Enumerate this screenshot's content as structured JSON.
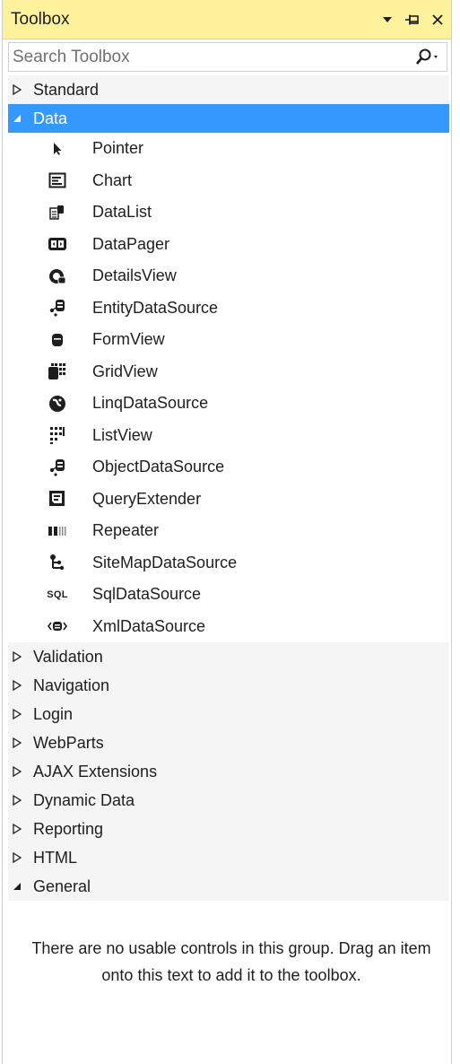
{
  "window": {
    "title": "Toolbox"
  },
  "search": {
    "placeholder": "Search Toolbox"
  },
  "groups_before": [
    {
      "label": "Standard",
      "expanded": false
    }
  ],
  "data_group": {
    "label": "Data",
    "expanded": true,
    "selected": true,
    "items": [
      {
        "label": "Pointer",
        "icon": "pointer-icon"
      },
      {
        "label": "Chart",
        "icon": "chart-icon"
      },
      {
        "label": "DataList",
        "icon": "datalist-icon"
      },
      {
        "label": "DataPager",
        "icon": "datapager-icon"
      },
      {
        "label": "DetailsView",
        "icon": "detailsview-icon"
      },
      {
        "label": "EntityDataSource",
        "icon": "entitydatasource-icon"
      },
      {
        "label": "FormView",
        "icon": "formview-icon"
      },
      {
        "label": "GridView",
        "icon": "gridview-icon"
      },
      {
        "label": "LinqDataSource",
        "icon": "linqdatasource-icon"
      },
      {
        "label": "ListView",
        "icon": "listview-icon"
      },
      {
        "label": "ObjectDataSource",
        "icon": "objectdatasource-icon"
      },
      {
        "label": "QueryExtender",
        "icon": "queryextender-icon"
      },
      {
        "label": "Repeater",
        "icon": "repeater-icon"
      },
      {
        "label": "SiteMapDataSource",
        "icon": "sitemapdatasource-icon"
      },
      {
        "label": "SqlDataSource",
        "icon": "sqldatasource-icon",
        "icon_text": "SQL"
      },
      {
        "label": "XmlDataSource",
        "icon": "xmldatasource-icon"
      }
    ]
  },
  "groups_after": [
    {
      "label": "Validation",
      "expanded": false
    },
    {
      "label": "Navigation",
      "expanded": false
    },
    {
      "label": "Login",
      "expanded": false
    },
    {
      "label": "WebParts",
      "expanded": false
    },
    {
      "label": "AJAX Extensions",
      "expanded": false
    },
    {
      "label": "Dynamic Data",
      "expanded": false
    },
    {
      "label": "Reporting",
      "expanded": false
    },
    {
      "label": "HTML",
      "expanded": false
    },
    {
      "label": "General",
      "expanded": true
    }
  ],
  "general": {
    "empty_message": "There are no usable controls in this group. Drag an item onto this text to add it to the toolbox."
  },
  "colors": {
    "title_bg": "#fff29d",
    "selected_bg": "#3399ff",
    "group_bg": "#f5f5f5"
  }
}
